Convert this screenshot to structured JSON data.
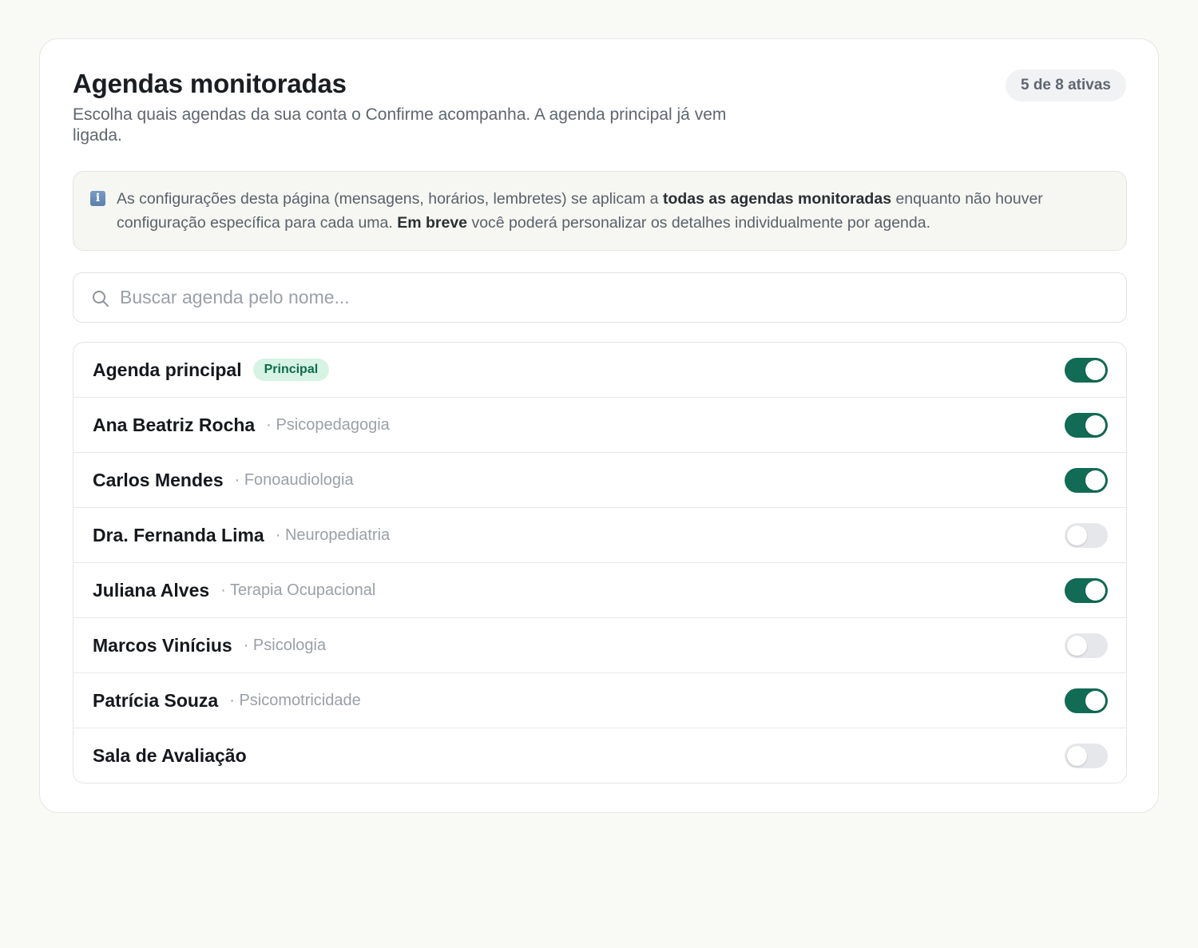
{
  "header": {
    "title": "Agendas monitoradas",
    "subtitle": "Escolha quais agendas da sua conta o Confirme acompanha. A agenda principal já vem ligada.",
    "count_badge": "5 de 8 ativas"
  },
  "info": {
    "icon": "info-icon",
    "text_1": "As configurações desta página (mensagens, horários, lembretes) se aplicam a ",
    "bold_1": "todas as agendas monitoradas",
    "text_2": " enquanto não houver configuração específica para cada uma. ",
    "bold_2": "Em breve",
    "text_3": " você poderá personalizar os detalhes individualmente por agenda."
  },
  "search": {
    "icon": "search-icon",
    "placeholder": "Buscar agenda pelo nome...",
    "value": ""
  },
  "agendas": [
    {
      "name": "Agenda principal",
      "tag": "Principal",
      "specialty": "",
      "enabled": true
    },
    {
      "name": "Ana Beatriz Rocha",
      "tag": "",
      "specialty": "Psicopedagogia",
      "enabled": true
    },
    {
      "name": "Carlos Mendes",
      "tag": "",
      "specialty": "Fonoaudiologia",
      "enabled": true
    },
    {
      "name": "Dra. Fernanda Lima",
      "tag": "",
      "specialty": "Neuropediatria",
      "enabled": false
    },
    {
      "name": "Juliana Alves",
      "tag": "",
      "specialty": "Terapia Ocupacional",
      "enabled": true
    },
    {
      "name": "Marcos Vinícius",
      "tag": "",
      "specialty": "Psicologia",
      "enabled": false
    },
    {
      "name": "Patrícia Souza",
      "tag": "",
      "specialty": "Psicomotricidade",
      "enabled": true
    },
    {
      "name": "Sala de Avaliação",
      "tag": "",
      "specialty": "",
      "enabled": false
    }
  ],
  "colors": {
    "toggle_on": "#126b54",
    "toggle_off": "#e6e7ea",
    "principal_tag_bg": "#d6f3e3",
    "principal_tag_text": "#0f6b4d"
  }
}
